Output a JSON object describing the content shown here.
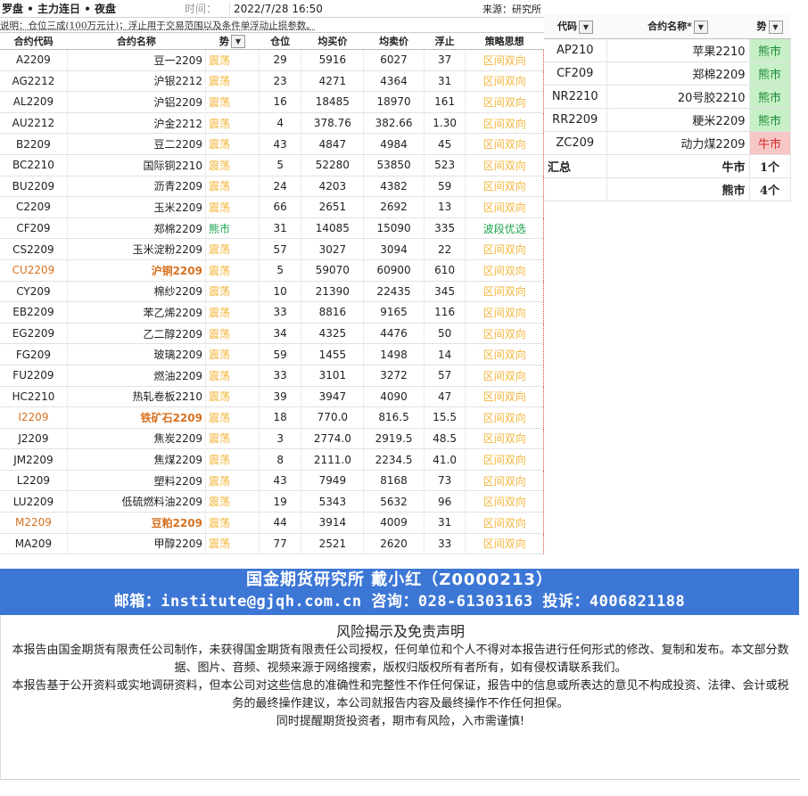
{
  "header": {
    "title": "罗盘 • 主力连日 • 夜盘",
    "time_label": "时间：",
    "time_value": "2022/7/28 16:50",
    "source": "来源：研究所",
    "note": "说明：仓位三成(100万元计)；浮止用于交易范围以及条件单浮动止损参数。"
  },
  "columns": [
    "合约代码",
    "合约名称",
    "势",
    "仓位",
    "均买价",
    "均卖价",
    "浮止",
    "策略思想"
  ],
  "rows": [
    {
      "code": "A2209",
      "name": "豆一2209",
      "trend": "震荡",
      "pos": "29",
      "buy": "5916",
      "sell": "6027",
      "stop": "37",
      "strat": "区间双向"
    },
    {
      "code": "AG2212",
      "name": "沪银2212",
      "trend": "震荡",
      "pos": "23",
      "buy": "4271",
      "sell": "4364",
      "stop": "31",
      "strat": "区间双向"
    },
    {
      "code": "AL2209",
      "name": "沪铝2209",
      "trend": "震荡",
      "pos": "16",
      "buy": "18485",
      "sell": "18970",
      "stop": "161",
      "strat": "区间双向"
    },
    {
      "code": "AU2212",
      "name": "沪金2212",
      "trend": "震荡",
      "pos": "4",
      "buy": "378.76",
      "sell": "382.66",
      "stop": "1.30",
      "strat": "区间双向"
    },
    {
      "code": "B2209",
      "name": "豆二2209",
      "trend": "震荡",
      "pos": "43",
      "buy": "4847",
      "sell": "4984",
      "stop": "45",
      "strat": "区间双向"
    },
    {
      "code": "BC2210",
      "name": "国际铜2210",
      "trend": "震荡",
      "pos": "5",
      "buy": "52280",
      "sell": "53850",
      "stop": "523",
      "strat": "区间双向"
    },
    {
      "code": "BU2209",
      "name": "沥青2209",
      "trend": "震荡",
      "pos": "24",
      "buy": "4203",
      "sell": "4382",
      "stop": "59",
      "strat": "区间双向"
    },
    {
      "code": "C2209",
      "name": "玉米2209",
      "trend": "震荡",
      "pos": "66",
      "buy": "2651",
      "sell": "2692",
      "stop": "13",
      "strat": "区间双向"
    },
    {
      "code": "CF209",
      "name": "郑棉2209",
      "trend": "熊市",
      "pos": "31",
      "buy": "14085",
      "sell": "15090",
      "stop": "335",
      "strat": "波段优选",
      "bear": true
    },
    {
      "code": "CS2209",
      "name": "玉米淀粉2209",
      "trend": "震荡",
      "pos": "57",
      "buy": "3027",
      "sell": "3094",
      "stop": "22",
      "strat": "区间双向"
    },
    {
      "code": "CU2209",
      "name": "沪铜2209",
      "trend": "震荡",
      "pos": "5",
      "buy": "59070",
      "sell": "60900",
      "stop": "610",
      "strat": "区间双向",
      "hl": true
    },
    {
      "code": "CY209",
      "name": "棉纱2209",
      "trend": "震荡",
      "pos": "10",
      "buy": "21390",
      "sell": "22435",
      "stop": "345",
      "strat": "区间双向"
    },
    {
      "code": "EB2209",
      "name": "苯乙烯2209",
      "trend": "震荡",
      "pos": "33",
      "buy": "8816",
      "sell": "9165",
      "stop": "116",
      "strat": "区间双向"
    },
    {
      "code": "EG2209",
      "name": "乙二醇2209",
      "trend": "震荡",
      "pos": "34",
      "buy": "4325",
      "sell": "4476",
      "stop": "50",
      "strat": "区间双向"
    },
    {
      "code": "FG209",
      "name": "玻璃2209",
      "trend": "震荡",
      "pos": "59",
      "buy": "1455",
      "sell": "1498",
      "stop": "14",
      "strat": "区间双向"
    },
    {
      "code": "FU2209",
      "name": "燃油2209",
      "trend": "震荡",
      "pos": "33",
      "buy": "3101",
      "sell": "3272",
      "stop": "57",
      "strat": "区间双向"
    },
    {
      "code": "HC2210",
      "name": "热轧卷板2210",
      "trend": "震荡",
      "pos": "39",
      "buy": "3947",
      "sell": "4090",
      "stop": "47",
      "strat": "区间双向"
    },
    {
      "code": "I2209",
      "name": "铁矿石2209",
      "trend": "震荡",
      "pos": "18",
      "buy": "770.0",
      "sell": "816.5",
      "stop": "15.5",
      "strat": "区间双向",
      "hl": true
    },
    {
      "code": "J2209",
      "name": "焦炭2209",
      "trend": "震荡",
      "pos": "3",
      "buy": "2774.0",
      "sell": "2919.5",
      "stop": "48.5",
      "strat": "区间双向"
    },
    {
      "code": "JM2209",
      "name": "焦煤2209",
      "trend": "震荡",
      "pos": "8",
      "buy": "2111.0",
      "sell": "2234.5",
      "stop": "41.0",
      "strat": "区间双向"
    },
    {
      "code": "L2209",
      "name": "塑料2209",
      "trend": "震荡",
      "pos": "43",
      "buy": "7949",
      "sell": "8168",
      "stop": "73",
      "strat": "区间双向"
    },
    {
      "code": "LU2209",
      "name": "低硫燃料油2209",
      "trend": "震荡",
      "pos": "19",
      "buy": "5343",
      "sell": "5632",
      "stop": "96",
      "strat": "区间双向"
    },
    {
      "code": "M2209",
      "name": "豆粕2209",
      "trend": "震荡",
      "pos": "44",
      "buy": "3914",
      "sell": "4009",
      "stop": "31",
      "strat": "区间双向",
      "hl": true
    },
    {
      "code": "MA209",
      "name": "甲醇2209",
      "trend": "震荡",
      "pos": "77",
      "buy": "2521",
      "sell": "2620",
      "stop": "33",
      "strat": "区间双向"
    }
  ],
  "side": {
    "columns": [
      "代码",
      "合约名称*",
      "势"
    ],
    "rows": [
      {
        "code": "AP210",
        "name": "苹果2210",
        "trend": "熊市",
        "type": "bear"
      },
      {
        "code": "CF209",
        "name": "郑棉2209",
        "trend": "熊市",
        "type": "bear"
      },
      {
        "code": "NR2210",
        "name": "20号胶2210",
        "trend": "熊市",
        "type": "bear"
      },
      {
        "code": "RR2209",
        "name": "粳米2209",
        "trend": "熊市",
        "type": "bear"
      },
      {
        "code": "ZC209",
        "name": "动力煤2209",
        "trend": "牛市",
        "type": "bull"
      }
    ],
    "summary_label": "汇总",
    "bull_label": "牛市",
    "bull_count": "1个",
    "bear_label": "熊市",
    "bear_count": "4个"
  },
  "banner": {
    "line1": "国金期货研究所    戴小红（Z0000213）",
    "line2": "邮箱：institute@gjqh.com.cn 咨询：028-61303163 投诉：4006821188"
  },
  "disclaimer": {
    "title": "风险揭示及免责声明",
    "p1": "本报告由国金期货有限责任公司制作，未获得国金期货有限责任公司授权，任何单位和个人不得对本报告进行任何形式的修改、复制和发布。本文部分数据、图片、音频、视频来源于网络搜索，版权归版权所有者所有，如有侵权请联系我们。",
    "p2": "本报告基于公开资料或实地调研资料，但本公司对这些信息的准确性和完整性不作任何保证，报告中的信息或所表达的意见不构成投资、法律、会计或税务的最终操作建议，本公司就报告内容及最终操作不作任何担保。",
    "p3": "同时提醒期货投资者，期市有风险，入市需谨慎!"
  },
  "colors": {
    "range": "#f3b53a",
    "bear": "#1aa34a",
    "bull": "#d02a2a",
    "highlight": "#d7711f",
    "banner": "#3d77d6"
  }
}
